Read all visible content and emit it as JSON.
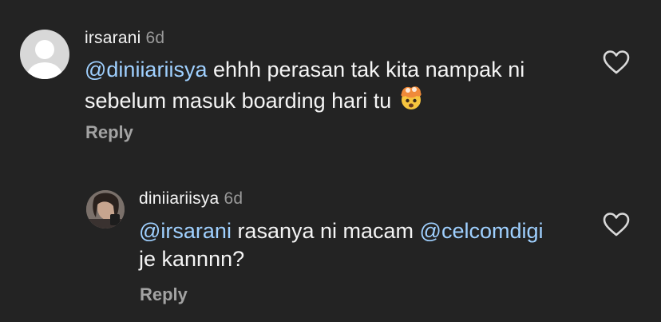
{
  "comments": [
    {
      "username": "irsarani",
      "time": "6d",
      "mention": "@diniiariisya",
      "text_line1": " ehhh perasan tak kita nampak ni",
      "text_line2": "sebelum masuk boarding hari tu",
      "emoji": "exploding-head-emoji",
      "reply_label": "Reply",
      "avatar": "default-avatar",
      "like_icon": "heart-outline-icon"
    },
    {
      "username": "diniiariisya",
      "time": "6d",
      "mention1": "@irsarani",
      "text_mid": " rasanya ni macam ",
      "mention2": "@celcomdigi",
      "text_line2": "je kannnn?",
      "reply_label": "Reply",
      "avatar": "profile-photo-avatar",
      "like_icon": "heart-outline-icon"
    }
  ],
  "colors": {
    "background": "#232323",
    "mention": "#9fd0ff",
    "muted": "#9a9a9a"
  }
}
